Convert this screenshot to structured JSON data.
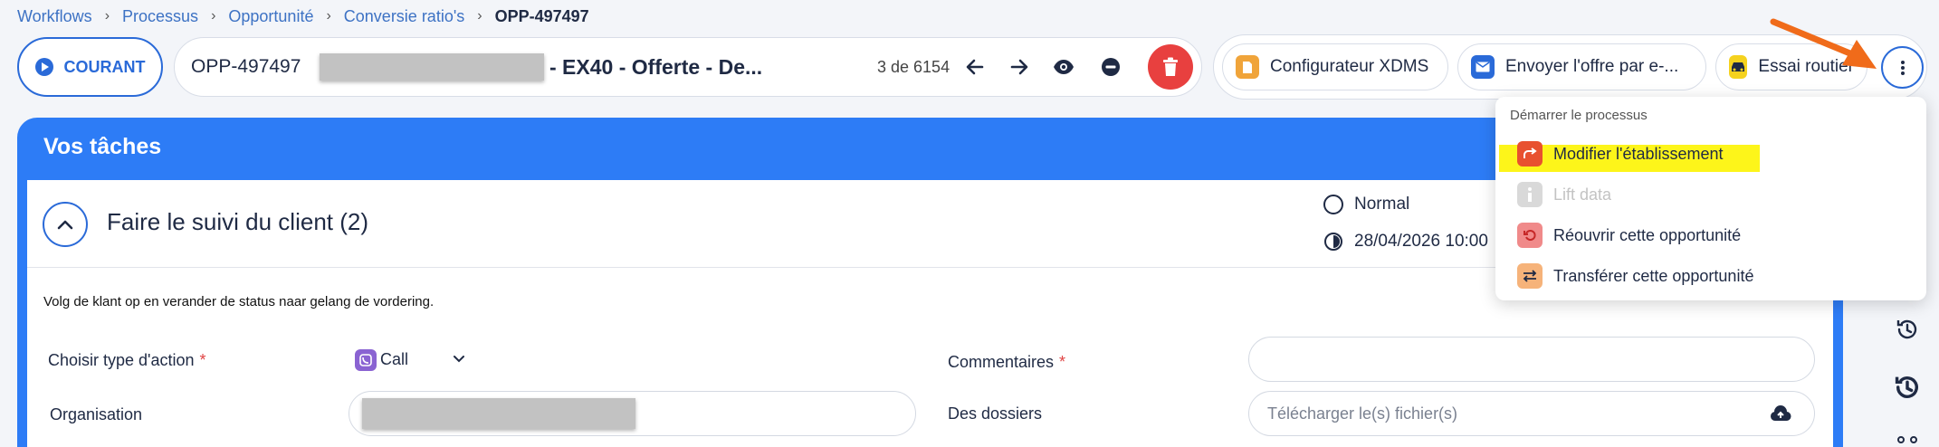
{
  "breadcrumb": {
    "items": [
      "Workflows",
      "Processus",
      "Opportunité",
      "Conversie ratio's"
    ],
    "current": "OPP-497497"
  },
  "header": {
    "status_label": "COURANT",
    "record_id": "OPP-497497",
    "record_name": "- EX40 - Offerte - De...",
    "pager": "3 de 6154"
  },
  "actions": [
    {
      "label": "Configurateur XDMS",
      "icon": "document-icon",
      "color": "#f0a43a"
    },
    {
      "label": "Envoyer l'offre par e-...",
      "icon": "mail-icon",
      "color": "#2a6ad8"
    },
    {
      "label": "Essai routier",
      "icon": "car-icon",
      "color": "#f5d21e"
    }
  ],
  "panel": {
    "title": "Vos tâches",
    "task_title": "Faire le suivi du client (2)",
    "priority": "Normal",
    "due_date": "28/04/2026 10:00",
    "description": "Volg de klant op en verander de status naar gelang de vordering."
  },
  "form": {
    "action_type_label": "Choisir type d'action",
    "action_type_value": "Call",
    "organisation_label": "Organisation",
    "comments_label": "Commentaires",
    "files_label": "Des dossiers",
    "files_placeholder": "Télécharger le(s) fichier(s)"
  },
  "menu": {
    "header": "Démarrer le processus",
    "items": [
      {
        "label": "Modifier l'établissement",
        "icon": "redirect-icon",
        "color": "#e8512f",
        "enabled": true
      },
      {
        "label": "Lift data",
        "icon": "info-icon",
        "color": "#cfcfcf",
        "enabled": false
      },
      {
        "label": "Réouvrir cette opportunité",
        "icon": "reopen-icon",
        "color": "#f08a8a",
        "enabled": true
      },
      {
        "label": "Transférer cette opportunité",
        "icon": "transfer-icon",
        "color": "#f6b37a",
        "enabled": true
      }
    ]
  },
  "colors": {
    "primary": "#2d7cf6",
    "accent_blue": "#2a6ad8",
    "delete": "#e8403f",
    "highlight": "#fdf51a",
    "annotation_arrow": "#f06b1a"
  }
}
